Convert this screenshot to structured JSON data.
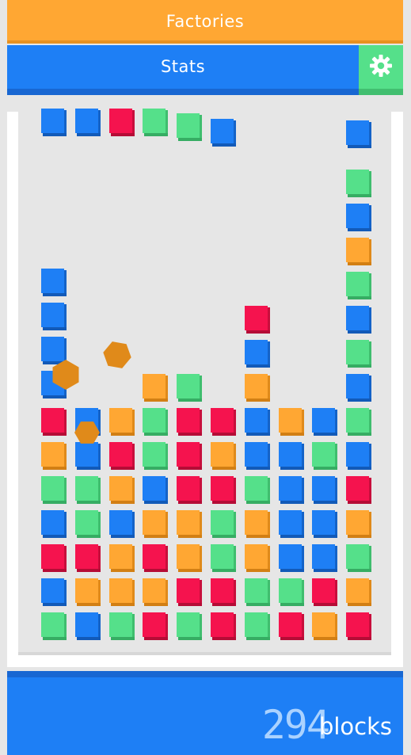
{
  "menu": {
    "factories_label": "Factories",
    "stats_label": "Stats",
    "settings_icon": "gear-icon"
  },
  "counter": {
    "value": "294",
    "unit": "blocks"
  },
  "colors": {
    "red": "#f5134e",
    "blue": "#1e7ff5",
    "green": "#55e08a",
    "orange": "#ffa733"
  },
  "blocks": [
    {
      "c": "blue",
      "col": 0,
      "row": 0
    },
    {
      "c": "blue",
      "col": 1,
      "row": 0
    },
    {
      "c": "red",
      "col": 2,
      "row": 0
    },
    {
      "c": "green",
      "col": 3,
      "row": 0
    },
    {
      "c": "green",
      "col": 4,
      "row": 0.15
    },
    {
      "c": "blue",
      "col": 5,
      "row": 0.3
    },
    {
      "c": "blue",
      "col": 9,
      "row": 0.35
    },
    {
      "c": "green",
      "col": 9,
      "row": 1.8
    },
    {
      "c": "blue",
      "col": 9,
      "row": 2.8
    },
    {
      "c": "orange",
      "col": 9,
      "row": 3.8
    },
    {
      "c": "green",
      "col": 9,
      "row": 4.8
    },
    {
      "c": "blue",
      "col": 9,
      "row": 5.8
    },
    {
      "c": "green",
      "col": 9,
      "row": 6.8
    },
    {
      "c": "blue",
      "col": 9,
      "row": 7.8
    },
    {
      "c": "blue",
      "col": 0,
      "row": 4.7
    },
    {
      "c": "blue",
      "col": 0,
      "row": 5.7
    },
    {
      "c": "blue",
      "col": 0,
      "row": 6.7
    },
    {
      "c": "blue",
      "col": 0,
      "row": 7.7
    },
    {
      "c": "red",
      "col": 6,
      "row": 5.8
    },
    {
      "c": "blue",
      "col": 6,
      "row": 6.8
    },
    {
      "c": "orange",
      "col": 6,
      "row": 7.8
    },
    {
      "c": "orange",
      "col": 3,
      "row": 7.8
    },
    {
      "c": "green",
      "col": 4,
      "row": 7.8
    },
    {
      "c": "red",
      "col": 0,
      "row": 8.8
    },
    {
      "c": "blue",
      "col": 1,
      "row": 8.8
    },
    {
      "c": "orange",
      "col": 2,
      "row": 8.8
    },
    {
      "c": "green",
      "col": 3,
      "row": 8.8
    },
    {
      "c": "red",
      "col": 4,
      "row": 8.8
    },
    {
      "c": "red",
      "col": 5,
      "row": 8.8
    },
    {
      "c": "blue",
      "col": 6,
      "row": 8.8
    },
    {
      "c": "orange",
      "col": 7,
      "row": 8.8
    },
    {
      "c": "blue",
      "col": 8,
      "row": 8.8
    },
    {
      "c": "green",
      "col": 9,
      "row": 8.8
    },
    {
      "c": "orange",
      "col": 0,
      "row": 9.8
    },
    {
      "c": "blue",
      "col": 1,
      "row": 9.8
    },
    {
      "c": "red",
      "col": 2,
      "row": 9.8
    },
    {
      "c": "green",
      "col": 3,
      "row": 9.8
    },
    {
      "c": "red",
      "col": 4,
      "row": 9.8
    },
    {
      "c": "orange",
      "col": 5,
      "row": 9.8
    },
    {
      "c": "blue",
      "col": 6,
      "row": 9.8
    },
    {
      "c": "blue",
      "col": 7,
      "row": 9.8
    },
    {
      "c": "green",
      "col": 8,
      "row": 9.8
    },
    {
      "c": "blue",
      "col": 9,
      "row": 9.8
    },
    {
      "c": "green",
      "col": 0,
      "row": 10.8
    },
    {
      "c": "green",
      "col": 1,
      "row": 10.8
    },
    {
      "c": "orange",
      "col": 2,
      "row": 10.8
    },
    {
      "c": "blue",
      "col": 3,
      "row": 10.8
    },
    {
      "c": "red",
      "col": 4,
      "row": 10.8
    },
    {
      "c": "red",
      "col": 5,
      "row": 10.8
    },
    {
      "c": "green",
      "col": 6,
      "row": 10.8
    },
    {
      "c": "blue",
      "col": 7,
      "row": 10.8
    },
    {
      "c": "blue",
      "col": 8,
      "row": 10.8
    },
    {
      "c": "red",
      "col": 9,
      "row": 10.8
    },
    {
      "c": "blue",
      "col": 0,
      "row": 11.8
    },
    {
      "c": "green",
      "col": 1,
      "row": 11.8
    },
    {
      "c": "blue",
      "col": 2,
      "row": 11.8
    },
    {
      "c": "orange",
      "col": 3,
      "row": 11.8
    },
    {
      "c": "orange",
      "col": 4,
      "row": 11.8
    },
    {
      "c": "green",
      "col": 5,
      "row": 11.8
    },
    {
      "c": "orange",
      "col": 6,
      "row": 11.8
    },
    {
      "c": "blue",
      "col": 7,
      "row": 11.8
    },
    {
      "c": "blue",
      "col": 8,
      "row": 11.8
    },
    {
      "c": "orange",
      "col": 9,
      "row": 11.8
    },
    {
      "c": "red",
      "col": 0,
      "row": 12.8
    },
    {
      "c": "red",
      "col": 1,
      "row": 12.8
    },
    {
      "c": "orange",
      "col": 2,
      "row": 12.8
    },
    {
      "c": "red",
      "col": 3,
      "row": 12.8
    },
    {
      "c": "orange",
      "col": 4,
      "row": 12.8
    },
    {
      "c": "green",
      "col": 5,
      "row": 12.8
    },
    {
      "c": "orange",
      "col": 6,
      "row": 12.8
    },
    {
      "c": "blue",
      "col": 7,
      "row": 12.8
    },
    {
      "c": "blue",
      "col": 8,
      "row": 12.8
    },
    {
      "c": "green",
      "col": 9,
      "row": 12.8
    },
    {
      "c": "blue",
      "col": 0,
      "row": 13.8
    },
    {
      "c": "orange",
      "col": 1,
      "row": 13.8
    },
    {
      "c": "orange",
      "col": 2,
      "row": 13.8
    },
    {
      "c": "orange",
      "col": 3,
      "row": 13.8
    },
    {
      "c": "red",
      "col": 4,
      "row": 13.8
    },
    {
      "c": "red",
      "col": 5,
      "row": 13.8
    },
    {
      "c": "green",
      "col": 6,
      "row": 13.8
    },
    {
      "c": "green",
      "col": 7,
      "row": 13.8
    },
    {
      "c": "red",
      "col": 8,
      "row": 13.8
    },
    {
      "c": "orange",
      "col": 9,
      "row": 13.8
    },
    {
      "c": "green",
      "col": 0,
      "row": 14.8
    },
    {
      "c": "blue",
      "col": 1,
      "row": 14.8
    },
    {
      "c": "green",
      "col": 2,
      "row": 14.8
    },
    {
      "c": "red",
      "col": 3,
      "row": 14.8
    },
    {
      "c": "green",
      "col": 4,
      "row": 14.8
    },
    {
      "c": "red",
      "col": 5,
      "row": 14.8
    },
    {
      "c": "green",
      "col": 6,
      "row": 14.8
    },
    {
      "c": "red",
      "col": 7,
      "row": 14.8
    },
    {
      "c": "orange",
      "col": 8,
      "row": 14.8
    },
    {
      "c": "red",
      "col": 9,
      "row": 14.8
    }
  ],
  "hexagons": [
    {
      "c": "orange"
    },
    {
      "c": "orange"
    },
    {
      "c": "orange"
    }
  ]
}
